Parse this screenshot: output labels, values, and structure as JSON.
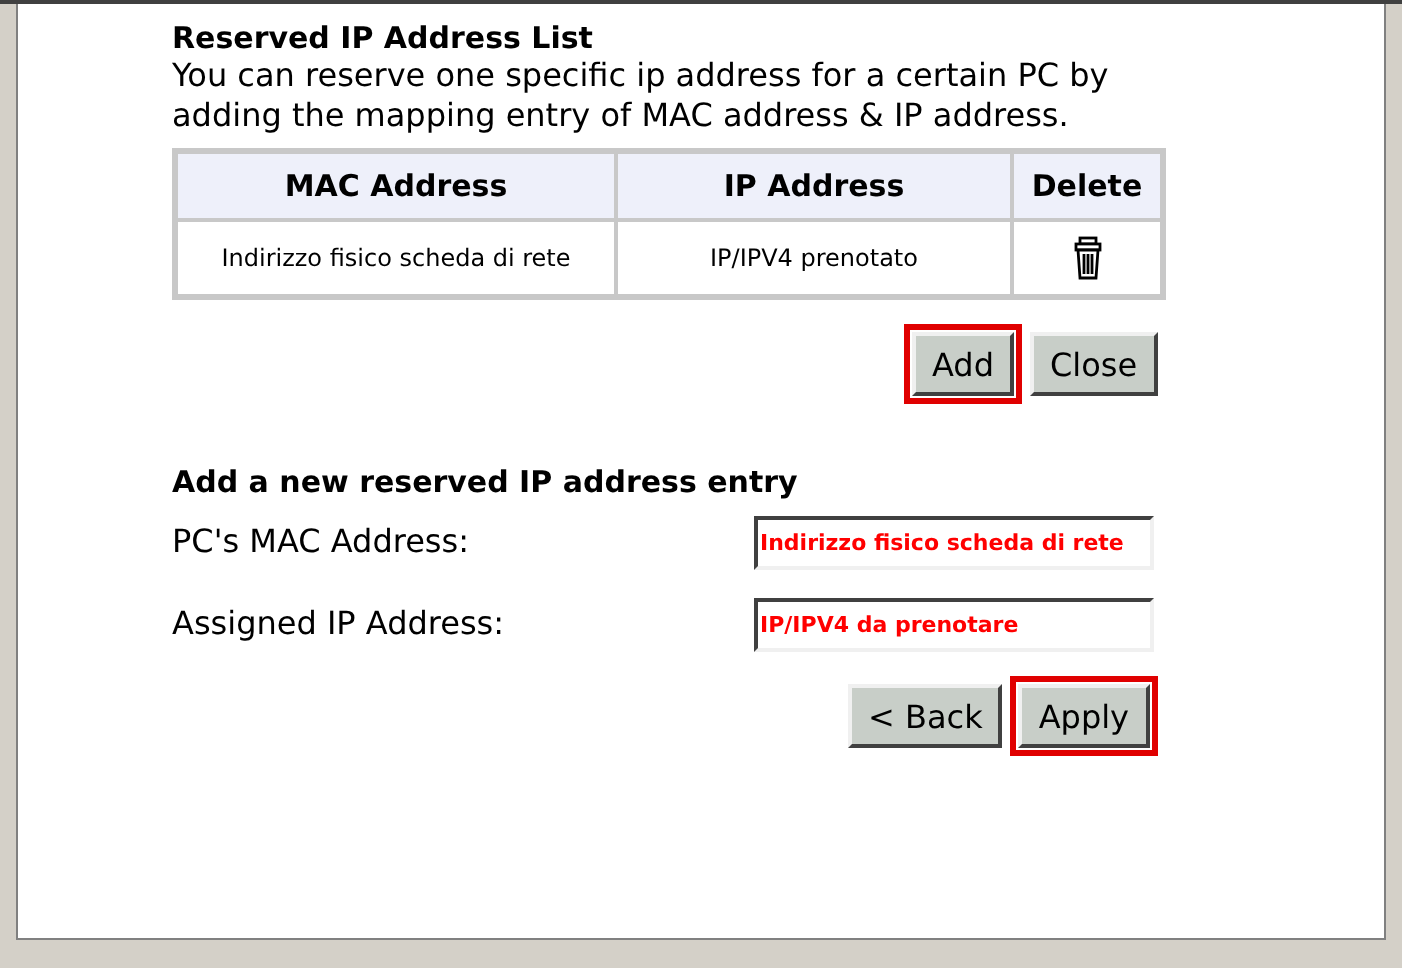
{
  "list_section": {
    "title": "Reserved IP Address List",
    "description": "You can reserve one specific ip address for a certain PC by adding the mapping entry of MAC address & IP address."
  },
  "table": {
    "columns": [
      "MAC Address",
      "IP Address",
      "Delete"
    ],
    "rows": [
      {
        "mac": "Indirizzo fisico scheda di rete",
        "ip": "IP/IPV4 prenotato"
      }
    ]
  },
  "list_buttons": [
    {
      "label": "Add",
      "highlighted": true
    },
    {
      "label": "Close",
      "highlighted": false
    }
  ],
  "add_section": {
    "title": "Add a new reserved IP address entry",
    "fields": [
      {
        "label": "PC's MAC Address:",
        "value": "Indirizzo fisico scheda di rete"
      },
      {
        "label": "Assigned IP Address:",
        "value": "IP/IPV4 da prenotare"
      }
    ]
  },
  "form_buttons": [
    {
      "label": "< Back",
      "highlighted": false
    },
    {
      "label": "Apply",
      "highlighted": true
    }
  ]
}
